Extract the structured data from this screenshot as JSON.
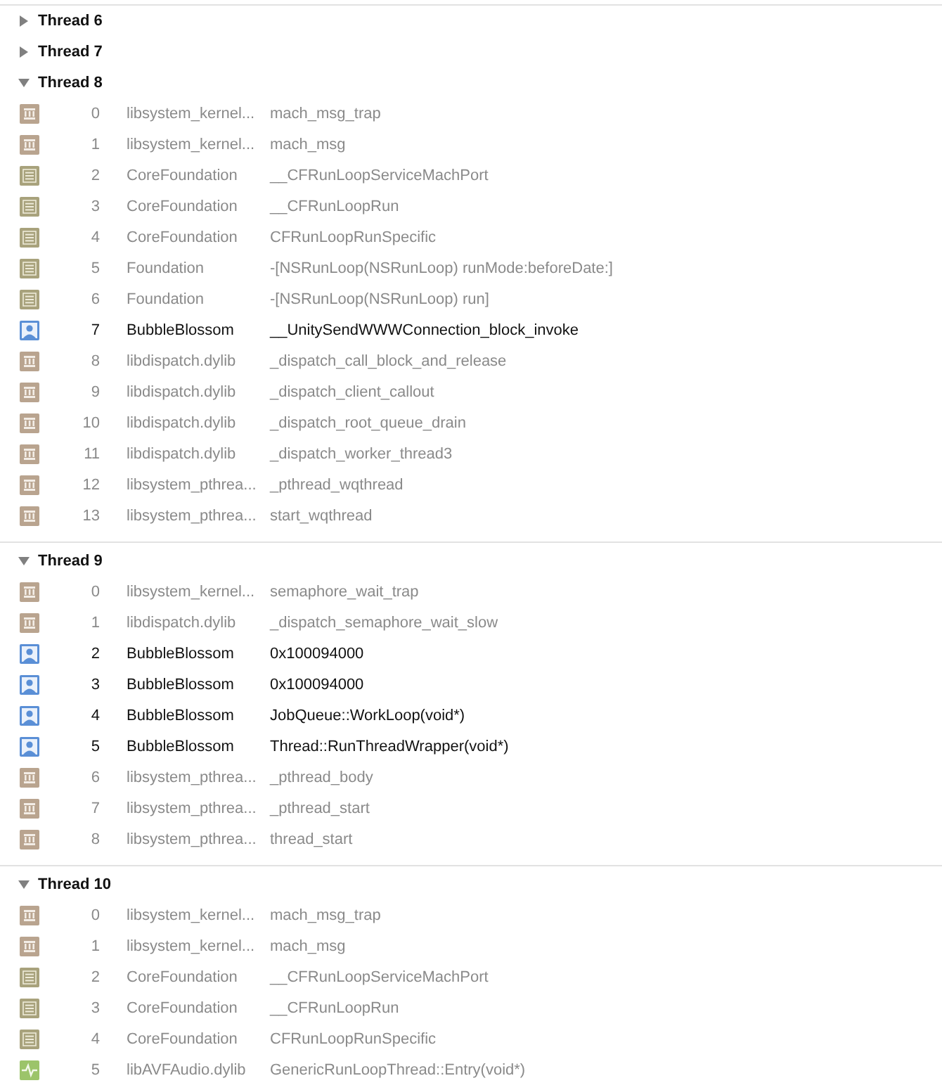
{
  "threads": [
    {
      "name": "Thread 6",
      "expanded": false
    },
    {
      "name": "Thread 7",
      "expanded": false
    },
    {
      "name": "Thread 8",
      "expanded": true,
      "frames": [
        {
          "kind": "system",
          "index": "0",
          "module": "libsystem_kernel...",
          "symbol": "mach_msg_trap"
        },
        {
          "kind": "system",
          "index": "1",
          "module": "libsystem_kernel...",
          "symbol": "mach_msg"
        },
        {
          "kind": "framework",
          "index": "2",
          "module": "CoreFoundation",
          "symbol": "__CFRunLoopServiceMachPort"
        },
        {
          "kind": "framework",
          "index": "3",
          "module": "CoreFoundation",
          "symbol": "__CFRunLoopRun"
        },
        {
          "kind": "framework",
          "index": "4",
          "module": "CoreFoundation",
          "symbol": "CFRunLoopRunSpecific"
        },
        {
          "kind": "framework",
          "index": "5",
          "module": "Foundation",
          "symbol": "-[NSRunLoop(NSRunLoop) runMode:beforeDate:]"
        },
        {
          "kind": "framework",
          "index": "6",
          "module": "Foundation",
          "symbol": "-[NSRunLoop(NSRunLoop) run]"
        },
        {
          "kind": "user",
          "index": "7",
          "module": "BubbleBlossom",
          "symbol": "__UnitySendWWWConnection_block_invoke"
        },
        {
          "kind": "system",
          "index": "8",
          "module": "libdispatch.dylib",
          "symbol": "_dispatch_call_block_and_release"
        },
        {
          "kind": "system",
          "index": "9",
          "module": "libdispatch.dylib",
          "symbol": "_dispatch_client_callout"
        },
        {
          "kind": "system",
          "index": "10",
          "module": "libdispatch.dylib",
          "symbol": "_dispatch_root_queue_drain"
        },
        {
          "kind": "system",
          "index": "11",
          "module": "libdispatch.dylib",
          "symbol": "_dispatch_worker_thread3"
        },
        {
          "kind": "system",
          "index": "12",
          "module": "libsystem_pthrea...",
          "symbol": "_pthread_wqthread"
        },
        {
          "kind": "system",
          "index": "13",
          "module": "libsystem_pthrea...",
          "symbol": "start_wqthread"
        }
      ]
    },
    {
      "name": "Thread 9",
      "expanded": true,
      "frames": [
        {
          "kind": "system",
          "index": "0",
          "module": "libsystem_kernel...",
          "symbol": "semaphore_wait_trap"
        },
        {
          "kind": "system",
          "index": "1",
          "module": "libdispatch.dylib",
          "symbol": "_dispatch_semaphore_wait_slow"
        },
        {
          "kind": "user",
          "index": "2",
          "module": "BubbleBlossom",
          "symbol": "0x100094000"
        },
        {
          "kind": "user",
          "index": "3",
          "module": "BubbleBlossom",
          "symbol": "0x100094000"
        },
        {
          "kind": "user",
          "index": "4",
          "module": "BubbleBlossom",
          "symbol": "JobQueue::WorkLoop(void*)"
        },
        {
          "kind": "user",
          "index": "5",
          "module": "BubbleBlossom",
          "symbol": "Thread::RunThreadWrapper(void*)"
        },
        {
          "kind": "system",
          "index": "6",
          "module": "libsystem_pthrea...",
          "symbol": "_pthread_body"
        },
        {
          "kind": "system",
          "index": "7",
          "module": "libsystem_pthrea...",
          "symbol": "_pthread_start"
        },
        {
          "kind": "system",
          "index": "8",
          "module": "libsystem_pthrea...",
          "symbol": "thread_start"
        }
      ]
    },
    {
      "name": "Thread 10",
      "expanded": true,
      "frames": [
        {
          "kind": "system",
          "index": "0",
          "module": "libsystem_kernel...",
          "symbol": "mach_msg_trap"
        },
        {
          "kind": "system",
          "index": "1",
          "module": "libsystem_kernel...",
          "symbol": "mach_msg"
        },
        {
          "kind": "framework",
          "index": "2",
          "module": "CoreFoundation",
          "symbol": "__CFRunLoopServiceMachPort"
        },
        {
          "kind": "framework",
          "index": "3",
          "module": "CoreFoundation",
          "symbol": "__CFRunLoopRun"
        },
        {
          "kind": "framework",
          "index": "4",
          "module": "CoreFoundation",
          "symbol": "CFRunLoopRunSpecific"
        },
        {
          "kind": "audio",
          "index": "5",
          "module": "libAVFAudio.dylib",
          "symbol": "GenericRunLoopThread::Entry(void*)"
        }
      ]
    }
  ]
}
